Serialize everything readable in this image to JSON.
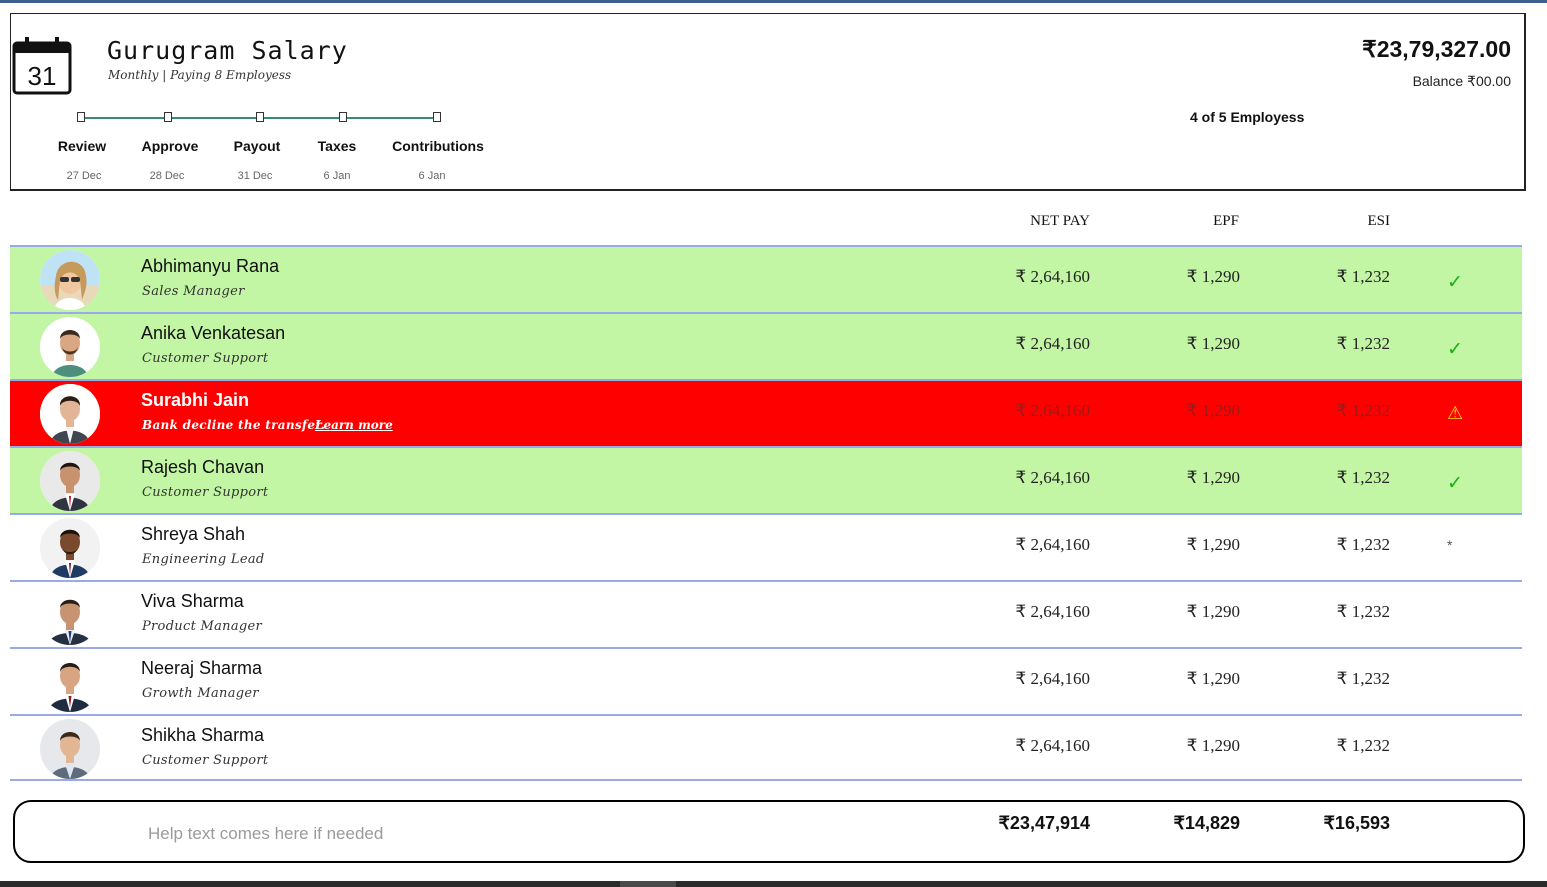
{
  "app": {
    "title": "Gurugram Salary",
    "subtitle": "Monthly | Paying 8 Employess",
    "calendar_day": "31",
    "total_amount": "₹23,79,327.00",
    "balance": "Balance ₹00.00",
    "employee_count": "4 of 5 Employess"
  },
  "steps": [
    {
      "label": "Review",
      "date": "27 Dec"
    },
    {
      "label": "Approve",
      "date": "28 Dec"
    },
    {
      "label": "Payout",
      "date": "31 Dec"
    },
    {
      "label": "Taxes",
      "date": "6 Jan"
    },
    {
      "label": "Contributions",
      "date": "6 Jan"
    }
  ],
  "columns": {
    "net_pay": "NET PAY",
    "epf": "EPF",
    "esi": "ESI"
  },
  "employees": [
    {
      "name": "Abhimanyu Rana",
      "role": "Sales Manager",
      "net_pay": "₹ 2,64,160",
      "epf": "₹ 1,290",
      "esi": "₹ 1,232",
      "status": "✓"
    },
    {
      "name": "Anika Venkatesan",
      "role": "Customer Support",
      "net_pay": "₹ 2,64,160",
      "epf": "₹ 1,290",
      "esi": "₹ 1,232",
      "status": "✓"
    },
    {
      "name": "Surabhi Jain",
      "role": "Bank decline the transfer.",
      "link": "Learn more",
      "net_pay": "₹ 2,64,160",
      "epf": "₹ 1,290",
      "esi": "₹ 1,232",
      "status": "⚠"
    },
    {
      "name": "Rajesh Chavan",
      "role": "Customer Support",
      "net_pay": "₹ 2,64,160",
      "epf": "₹ 1,290",
      "esi": "₹ 1,232",
      "status": "✓"
    },
    {
      "name": "Shreya Shah",
      "role": "Engineering Lead",
      "net_pay": "₹ 2,64,160",
      "epf": "₹ 1,290",
      "esi": "₹ 1,232",
      "status": "*"
    },
    {
      "name": "Viva Sharma",
      "role": "Product Manager",
      "net_pay": "₹ 2,64,160",
      "epf": "₹ 1,290",
      "esi": "₹ 1,232",
      "status": ""
    },
    {
      "name": "Neeraj Sharma",
      "role": "Growth Manager",
      "net_pay": "₹ 2,64,160",
      "epf": "₹ 1,290",
      "esi": "₹ 1,232",
      "status": ""
    },
    {
      "name": "Shikha Sharma",
      "role": "Customer Support",
      "net_pay": "₹ 2,64,160",
      "epf": "₹ 1,290",
      "esi": "₹ 1,232",
      "status": ""
    }
  ],
  "footer": {
    "help_text": "Help text comes here if needed",
    "total_net_pay": "₹23,47,914",
    "total_epf": "₹14,829",
    "total_esi": "₹16,593"
  },
  "colors": {
    "paid_row": "#c2f6a4",
    "error_row": "#ff0000",
    "check": "#12b312",
    "warning": "#ffd21a",
    "step_line": "#3a8c77"
  }
}
